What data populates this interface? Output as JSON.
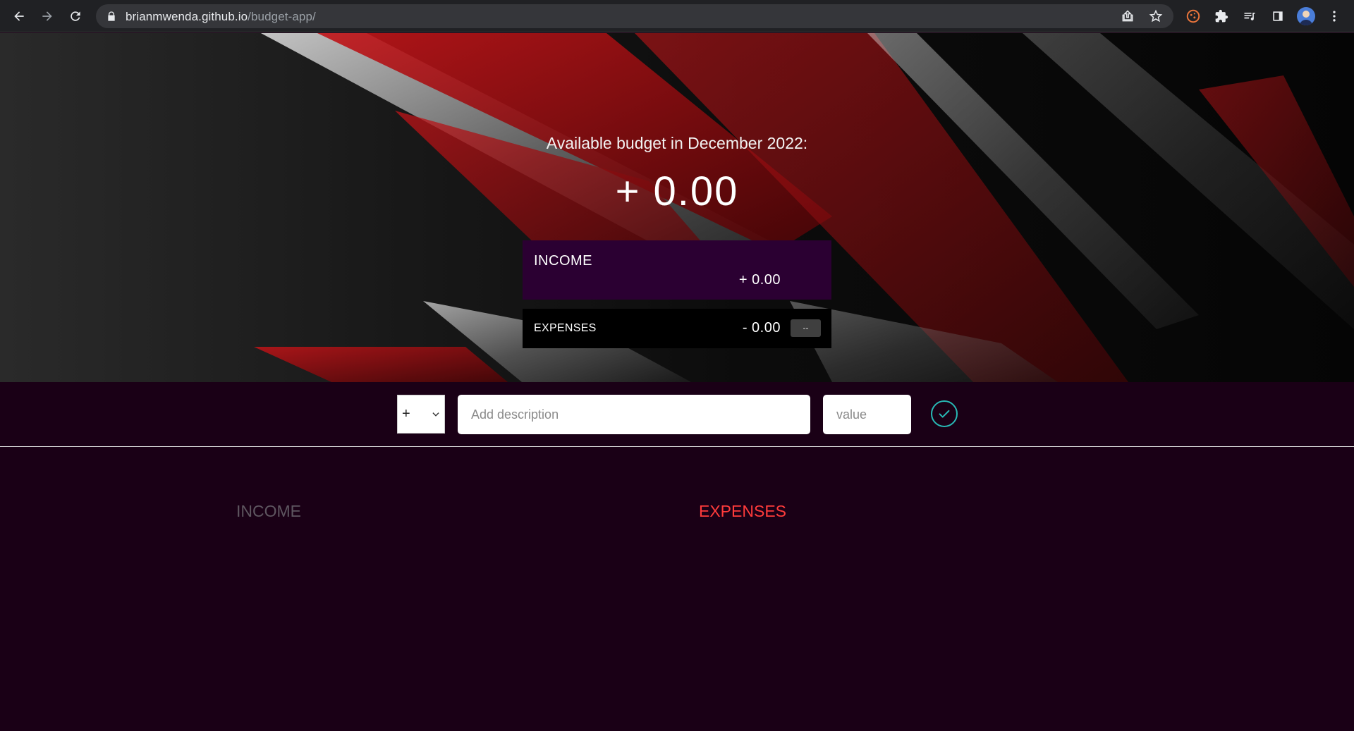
{
  "browser": {
    "url_domain": "brianmwenda.github.io",
    "url_path": "/budget-app/",
    "icons": [
      "back-icon",
      "forward-icon",
      "reload-icon",
      "lock-icon",
      "share-icon",
      "bookmark-star-icon",
      "cookie-extension-icon",
      "puzzle-extensions-icon",
      "reading-list-icon",
      "side-panel-icon",
      "profile-avatar",
      "menu-dots-icon"
    ]
  },
  "budget": {
    "title": "Available budget in December 2022:",
    "value": "+ 0.00"
  },
  "summary": {
    "income_label": "INCOME",
    "income_value": "+ 0.00",
    "expenses_label": "EXPENSES",
    "expenses_value": "- 0.00",
    "expenses_percentage": "--"
  },
  "add_form": {
    "type_selected": "+",
    "description_placeholder": "Add description",
    "value_placeholder": "value"
  },
  "lists": {
    "income_heading": "INCOME",
    "expenses_heading": "EXPENSES"
  },
  "colors": {
    "income_card": "#2b0032",
    "page_bg": "#1a0016",
    "expenses_heading": "#ff3b3b",
    "add_button": "#28b9b5"
  }
}
